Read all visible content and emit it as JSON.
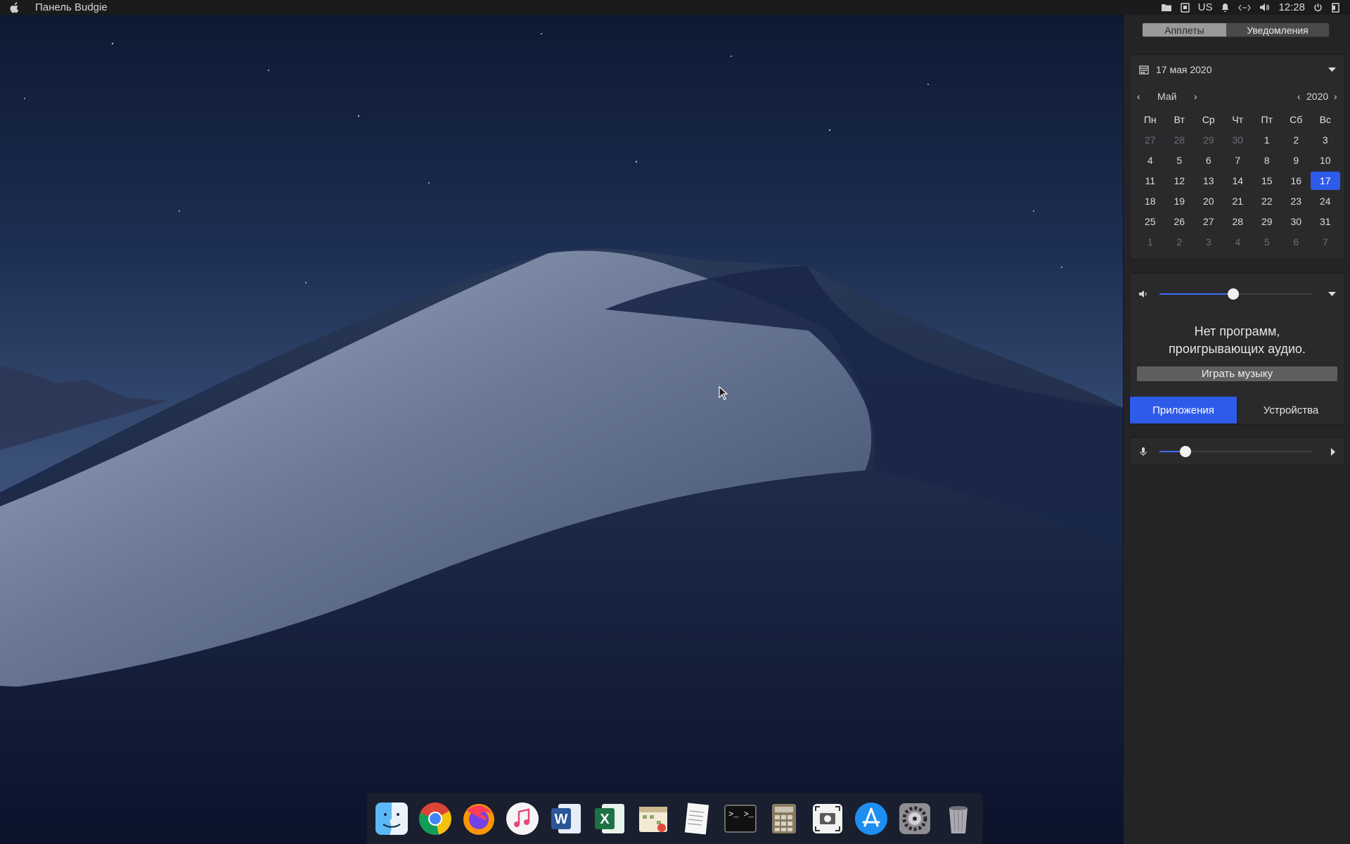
{
  "topbar": {
    "apple_icon": "apple-icon",
    "menu_title": "Панель Budgie",
    "keyboard_layout": "US",
    "clock": "12:28",
    "tray_icons": [
      "folder-icon",
      "sd-card-icon",
      "bell-icon",
      "network-icon",
      "volume-icon",
      "power-icon",
      "logout-icon"
    ]
  },
  "raven": {
    "tabs": {
      "applets": "Апплеты",
      "notifications": "Уведомления"
    },
    "calendar": {
      "header_date": "17 мая 2020",
      "month": "Май",
      "year": "2020",
      "weekdays": [
        "Пн",
        "Вт",
        "Ср",
        "Чт",
        "Пт",
        "Сб",
        "Вс"
      ],
      "weeks": [
        [
          "27",
          "28",
          "29",
          "30",
          "1",
          "2",
          "3"
        ],
        [
          "4",
          "5",
          "6",
          "7",
          "8",
          "9",
          "10"
        ],
        [
          "11",
          "12",
          "13",
          "14",
          "15",
          "16",
          "17"
        ],
        [
          "18",
          "19",
          "20",
          "21",
          "22",
          "23",
          "24"
        ],
        [
          "25",
          "26",
          "27",
          "28",
          "29",
          "30",
          "31"
        ],
        [
          "1",
          "2",
          "3",
          "4",
          "5",
          "6",
          "7"
        ]
      ],
      "selected_day": "17"
    },
    "sound": {
      "output_volume": 0.48,
      "no_audio_line1": "Нет программ,",
      "no_audio_line2": "проигрывающих аудио.",
      "play_music": "Играть музыку",
      "tab_apps": "Приложения",
      "tab_devices": "Устройства",
      "input_volume": 0.17
    },
    "accent_color": "#2f5bea"
  },
  "dock": {
    "items": [
      "finder-icon",
      "chrome-icon",
      "firefox-icon",
      "music-icon",
      "word-icon",
      "excel-icon",
      "calendar-app-icon",
      "text-editor-icon",
      "terminal-icon",
      "calculator-icon",
      "screenshot-icon",
      "app-store-icon",
      "settings-icon",
      "trash-icon"
    ]
  }
}
